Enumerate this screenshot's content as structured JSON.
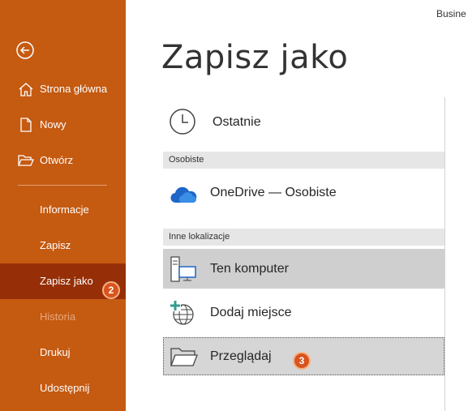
{
  "header": {
    "account_label": "Busine",
    "title": "Zapisz jako"
  },
  "sidebar": {
    "top_items": [
      {
        "label": "Strona główna",
        "icon": "home-icon"
      },
      {
        "label": "Nowy",
        "icon": "new-document-icon"
      },
      {
        "label": "Otwórz",
        "icon": "open-folder-icon"
      }
    ],
    "items": [
      {
        "label": "Informacje"
      },
      {
        "label": "Zapisz"
      },
      {
        "label": "Zapisz jako",
        "active": true,
        "badge": "2"
      },
      {
        "label": "Historia",
        "disabled": true
      },
      {
        "label": "Drukuj"
      },
      {
        "label": "Udostępnij"
      }
    ]
  },
  "locations": {
    "recent": {
      "label": "Ostatnie",
      "icon": "clock-icon"
    },
    "personal_header": "Osobiste",
    "onedrive": {
      "label": "OneDrive — Osobiste",
      "icon": "cloud-icon"
    },
    "other_header": "Inne lokalizacje",
    "this_pc": {
      "label": "Ten komputer",
      "icon": "computer-icon"
    },
    "add_place": {
      "label": "Dodaj miejsce",
      "icon": "add-place-globe-icon"
    },
    "browse": {
      "label": "Przeglądaj",
      "icon": "folder-icon",
      "badge": "3"
    }
  },
  "colors": {
    "sidebar": "#c55a11",
    "sidebar_active": "#962f07",
    "badge": "#d9531e",
    "onedrive": "#1e66c8"
  }
}
